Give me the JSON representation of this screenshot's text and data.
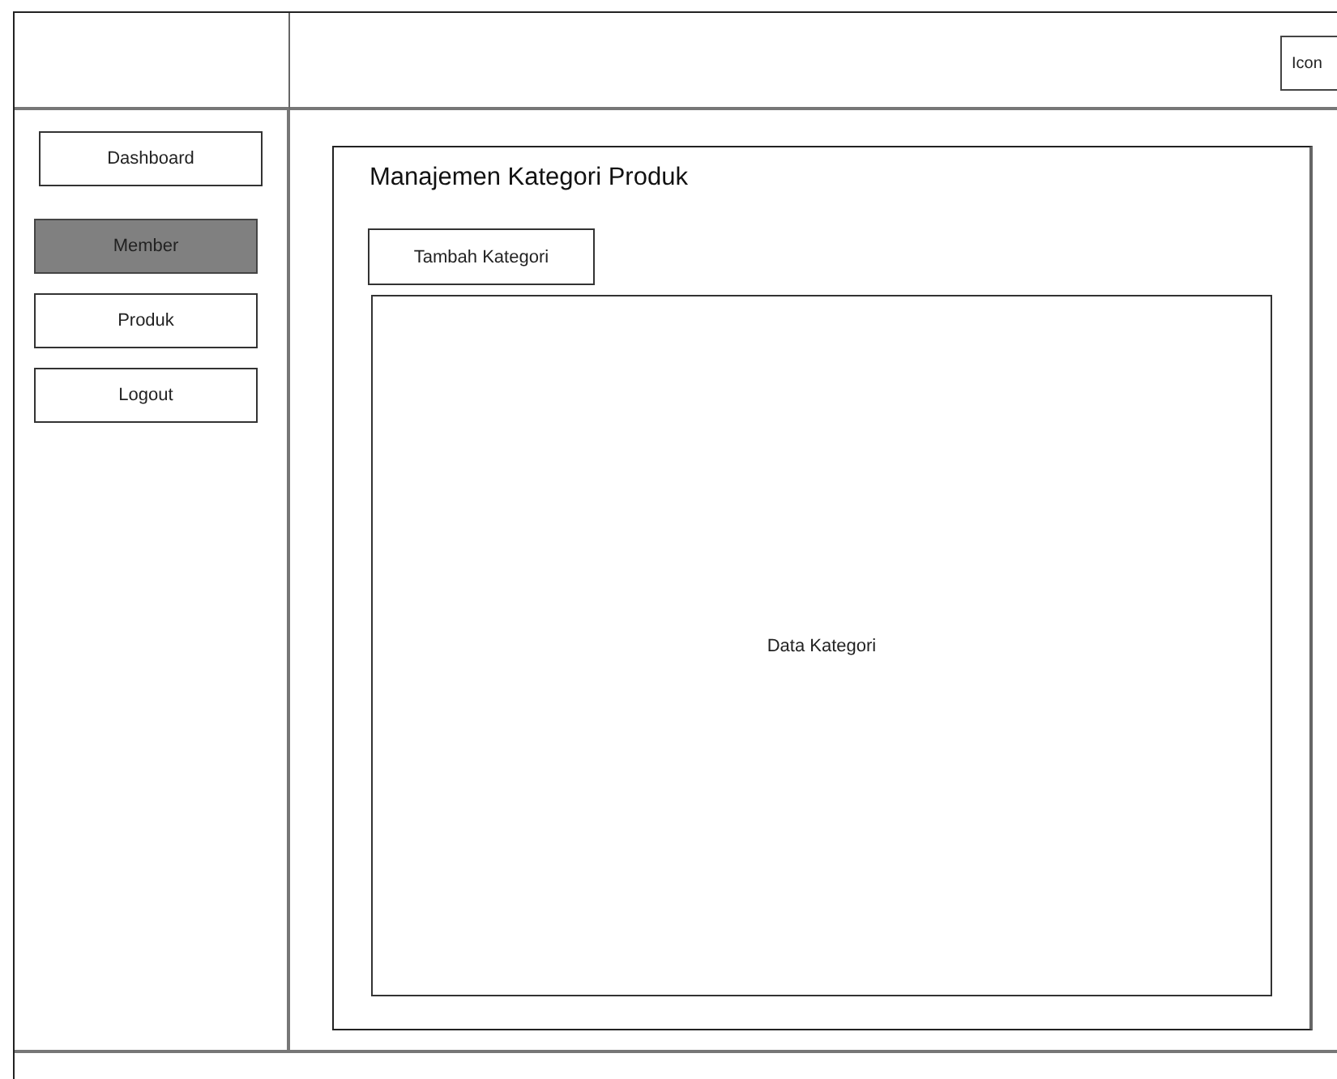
{
  "header": {
    "icon_button": "Icon"
  },
  "sidebar": {
    "items": [
      {
        "label": "Dashboard",
        "selected": false
      },
      {
        "label": "Member",
        "selected": true
      },
      {
        "label": "Produk",
        "selected": false
      },
      {
        "label": "Logout",
        "selected": false
      }
    ]
  },
  "content": {
    "title": "Manajemen Kategori Produk",
    "add_button": "Tambah Kategori",
    "table_placeholder": "Data Kategori"
  }
}
